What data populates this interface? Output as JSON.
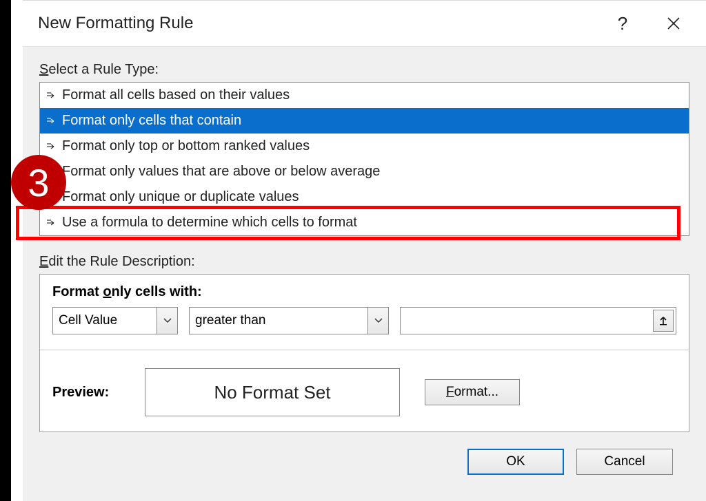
{
  "dialog": {
    "title": "New Formatting Rule",
    "help_symbol": "?",
    "select_label_pre": "S",
    "select_label_rest": "elect a Rule Type:",
    "rule_types": [
      "Format all cells based on their values",
      "Format only cells that contain",
      "Format only top or bottom ranked values",
      "Format only values that are above or below average",
      "Format only unique or duplicate values",
      "Use a formula to determine which cells to format"
    ],
    "edit_label_pre": "E",
    "edit_label_rest": "dit the Rule Description:",
    "format_only_pre": "Format ",
    "format_only_ul": "o",
    "format_only_rest": "nly cells with:",
    "combo1_value": "Cell Value",
    "combo2_value": "greater than",
    "formula_value": "",
    "preview_label": "Preview:",
    "preview_text": "No Format Set",
    "format_btn_ul": "F",
    "format_btn_rest": "ormat...",
    "ok_label": "OK",
    "cancel_label": "Cancel"
  },
  "annotation": {
    "badge": "3"
  }
}
